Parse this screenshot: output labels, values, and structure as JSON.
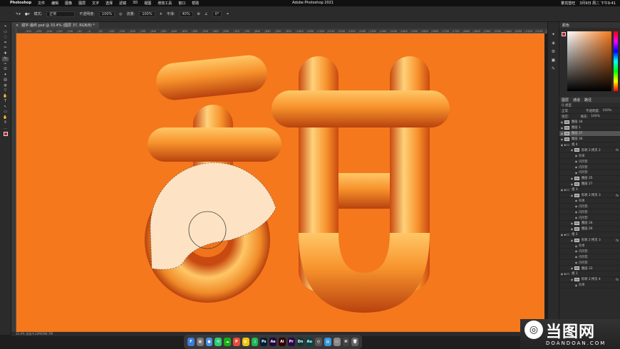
{
  "menubar": {
    "apple": "",
    "items": [
      "Photoshop",
      "文件",
      "编辑",
      "图像",
      "图层",
      "文字",
      "选择",
      "滤镜",
      "3D",
      "视图",
      "增效工具",
      "窗口",
      "帮助"
    ],
    "title": "Adobe Photoshop 2021",
    "right": [
      "繁花签旺",
      "3月9日 周二 下午9:41"
    ]
  },
  "options": {
    "mode_label": "模式:",
    "mode_value": "正常",
    "opacity_label": "不透明度:",
    "opacity_value": "100%",
    "flow_label": "流量:",
    "flow_value": "100%",
    "smooth_label": "平滑:",
    "smooth_value": "40%",
    "angle_value": "0°"
  },
  "tab": {
    "label": "甜字-最终.psd @ 33.4% (图层 37, RGB/8) *",
    "close": "×"
  },
  "ruler": [
    "300",
    "250",
    "200",
    "150",
    "100",
    "50",
    "0",
    "50",
    "100",
    "150",
    "200",
    "250",
    "300",
    "350",
    "400",
    "450",
    "500",
    "550",
    "600",
    "650",
    "700",
    "750",
    "800",
    "850",
    "900",
    "950",
    "1000",
    "1050",
    "1100",
    "1150",
    "1200",
    "1250",
    "1300",
    "1350",
    "1400",
    "1450",
    "1500",
    "1550",
    "1600",
    "1650",
    "1700",
    "1750",
    "1800",
    "1850",
    "1900",
    "1950",
    "2000",
    "2050",
    "2100",
    "2150",
    "2200"
  ],
  "status": "33.4%    文档:6.22M/394.7M",
  "tools": [
    "⌖",
    "▭",
    "◌",
    "⌗",
    "✂",
    "✚",
    "✎",
    "✑",
    "⎚",
    "✦",
    "▤",
    "◍",
    "▽",
    "✋",
    "T",
    "↖",
    "▭",
    "✋",
    "⚲",
    "…"
  ],
  "dock": [
    {
      "label": "F",
      "color": "#3b7bdc"
    },
    {
      "label": "▦",
      "color": "#777"
    },
    {
      "label": "●",
      "color": "#4a90e2"
    },
    {
      "label": "✉",
      "color": "#2ecc71"
    },
    {
      "label": "☁",
      "color": "#1aad19"
    },
    {
      "label": "P",
      "color": "#e74c3c"
    },
    {
      "label": "◐",
      "color": "#f1c40f"
    },
    {
      "label": "♫",
      "color": "#1db954"
    },
    {
      "label": "Ps",
      "color": "#001e36"
    },
    {
      "label": "Ae",
      "color": "#1f0740"
    },
    {
      "label": "Ai",
      "color": "#330000"
    },
    {
      "label": "Pr",
      "color": "#2a0a4a"
    },
    {
      "label": "Dn",
      "color": "#0c3a3a"
    },
    {
      "label": "Au",
      "color": "#00464a"
    },
    {
      "label": "◴",
      "color": "#555"
    },
    {
      "label": "▤",
      "color": "#3498db"
    },
    {
      "label": "▭",
      "color": "#888"
    },
    {
      "label": "⌘",
      "color": "#444"
    },
    {
      "label": "🗑",
      "color": "#666"
    }
  ],
  "rightIcons": [
    "✦",
    "◈",
    "⚙",
    "▣",
    "✎"
  ],
  "colorPanel": {
    "tab": "颜色"
  },
  "layersPanel": {
    "tabs": [
      "图层",
      "通道",
      "路径"
    ],
    "kind": "Q 类型",
    "blend": "正常",
    "opacity_label": "不透明度:",
    "opacity_value": "100%",
    "lock_label": "锁定:",
    "fill_label": "填充:",
    "fill_value": "100%"
  },
  "layers": [
    {
      "name": "图层 34",
      "cls": ""
    },
    {
      "name": "图层 1",
      "cls": ""
    },
    {
      "name": "图层 37",
      "cls": "sel"
    },
    {
      "name": "图层 36",
      "cls": ""
    },
    {
      "name": "组 4",
      "cls": "group"
    },
    {
      "name": "形状 2 拷贝 2",
      "cls": "sub",
      "fx": "fx"
    },
    {
      "name": "效果",
      "cls": "subsub"
    },
    {
      "name": "内阴影",
      "cls": "subsub"
    },
    {
      "name": "内阴影",
      "cls": "subsub"
    },
    {
      "name": "内阴影",
      "cls": "subsub"
    },
    {
      "name": "图层 35",
      "cls": "sub"
    },
    {
      "name": "图层 27",
      "cls": "sub"
    },
    {
      "name": "组 3",
      "cls": "group"
    },
    {
      "name": "形状 2 拷贝 3",
      "cls": "sub",
      "fx": "fx"
    },
    {
      "name": "效果",
      "cls": "subsub"
    },
    {
      "name": "内阴影",
      "cls": "subsub"
    },
    {
      "name": "内阴影",
      "cls": "subsub"
    },
    {
      "name": "内阴影",
      "cls": "subsub"
    },
    {
      "name": "图层 34",
      "cls": "sub"
    },
    {
      "name": "图层 26",
      "cls": "sub"
    },
    {
      "name": "组 2",
      "cls": "group"
    },
    {
      "name": "形状 2 拷贝 3",
      "cls": "sub",
      "fx": "fx"
    },
    {
      "name": "效果",
      "cls": "subsub"
    },
    {
      "name": "内阴影",
      "cls": "subsub"
    },
    {
      "name": "内阴影",
      "cls": "subsub"
    },
    {
      "name": "内阴影",
      "cls": "subsub"
    },
    {
      "name": "图层 33",
      "cls": "sub"
    },
    {
      "name": "组 1",
      "cls": "group"
    },
    {
      "name": "形状 2 拷贝 4",
      "cls": "sub",
      "fx": "fx"
    },
    {
      "name": "效果",
      "cls": "subsub"
    }
  ],
  "watermark": {
    "big": "当图网",
    "small": "DOANDOAN.COM",
    "logo": "◎"
  },
  "colors": {
    "canvas": "#f5781d",
    "tube_light": "#ffd27a",
    "tube_dark": "#c94a10",
    "selection_fill": "#fde3c4"
  }
}
